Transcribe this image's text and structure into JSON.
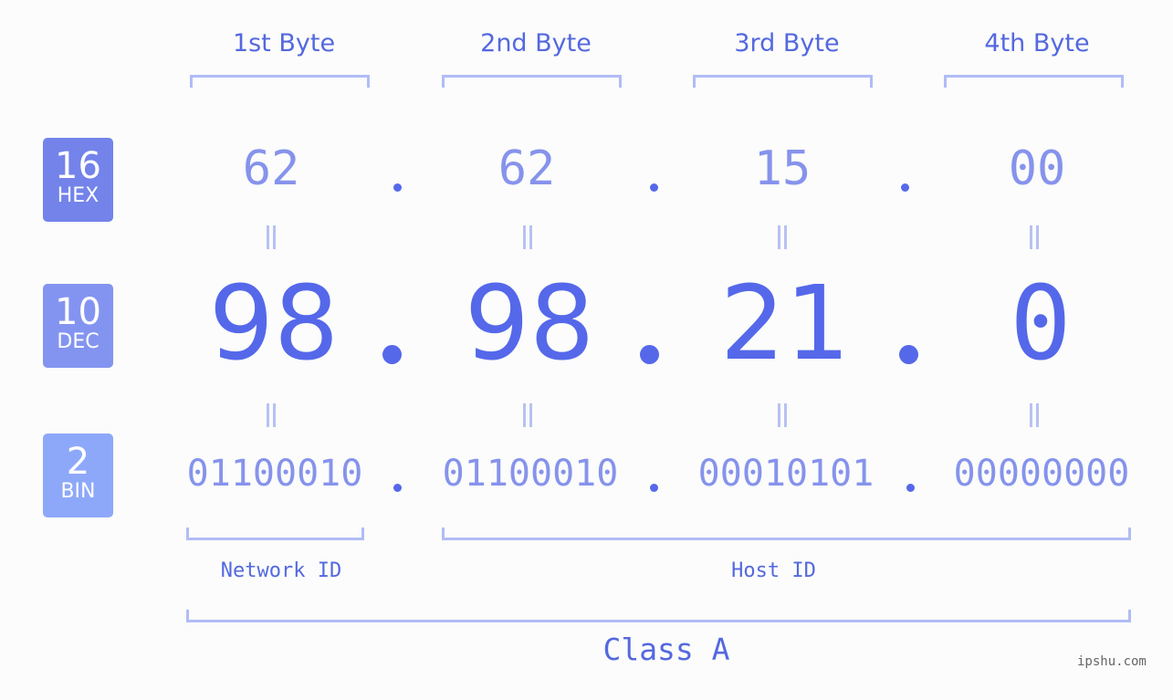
{
  "header": {
    "bytes": [
      "1st Byte",
      "2nd Byte",
      "3rd Byte",
      "4th Byte"
    ]
  },
  "badges": {
    "hex": {
      "number": "16",
      "label": "HEX",
      "color": "#7383ea"
    },
    "dec": {
      "number": "10",
      "label": "DEC",
      "color": "#8394f0"
    },
    "bin": {
      "number": "2",
      "label": "BIN",
      "color": "#8ea8f9"
    }
  },
  "ip": {
    "hex": [
      "62",
      "62",
      "15",
      "00"
    ],
    "dec": [
      "98",
      "98",
      "21",
      "0"
    ],
    "bin": [
      "01100010",
      "01100010",
      "00010101",
      "00000000"
    ],
    "separator": "."
  },
  "segments": {
    "network_label": "Network ID",
    "host_label": "Host ID",
    "class_label": "Class A"
  },
  "colors": {
    "accent": "#5568ea",
    "light_value": "#8693ec",
    "bracket": "#b1bcf6",
    "background": "#fbfcfb"
  },
  "watermark": "ipshu.com"
}
